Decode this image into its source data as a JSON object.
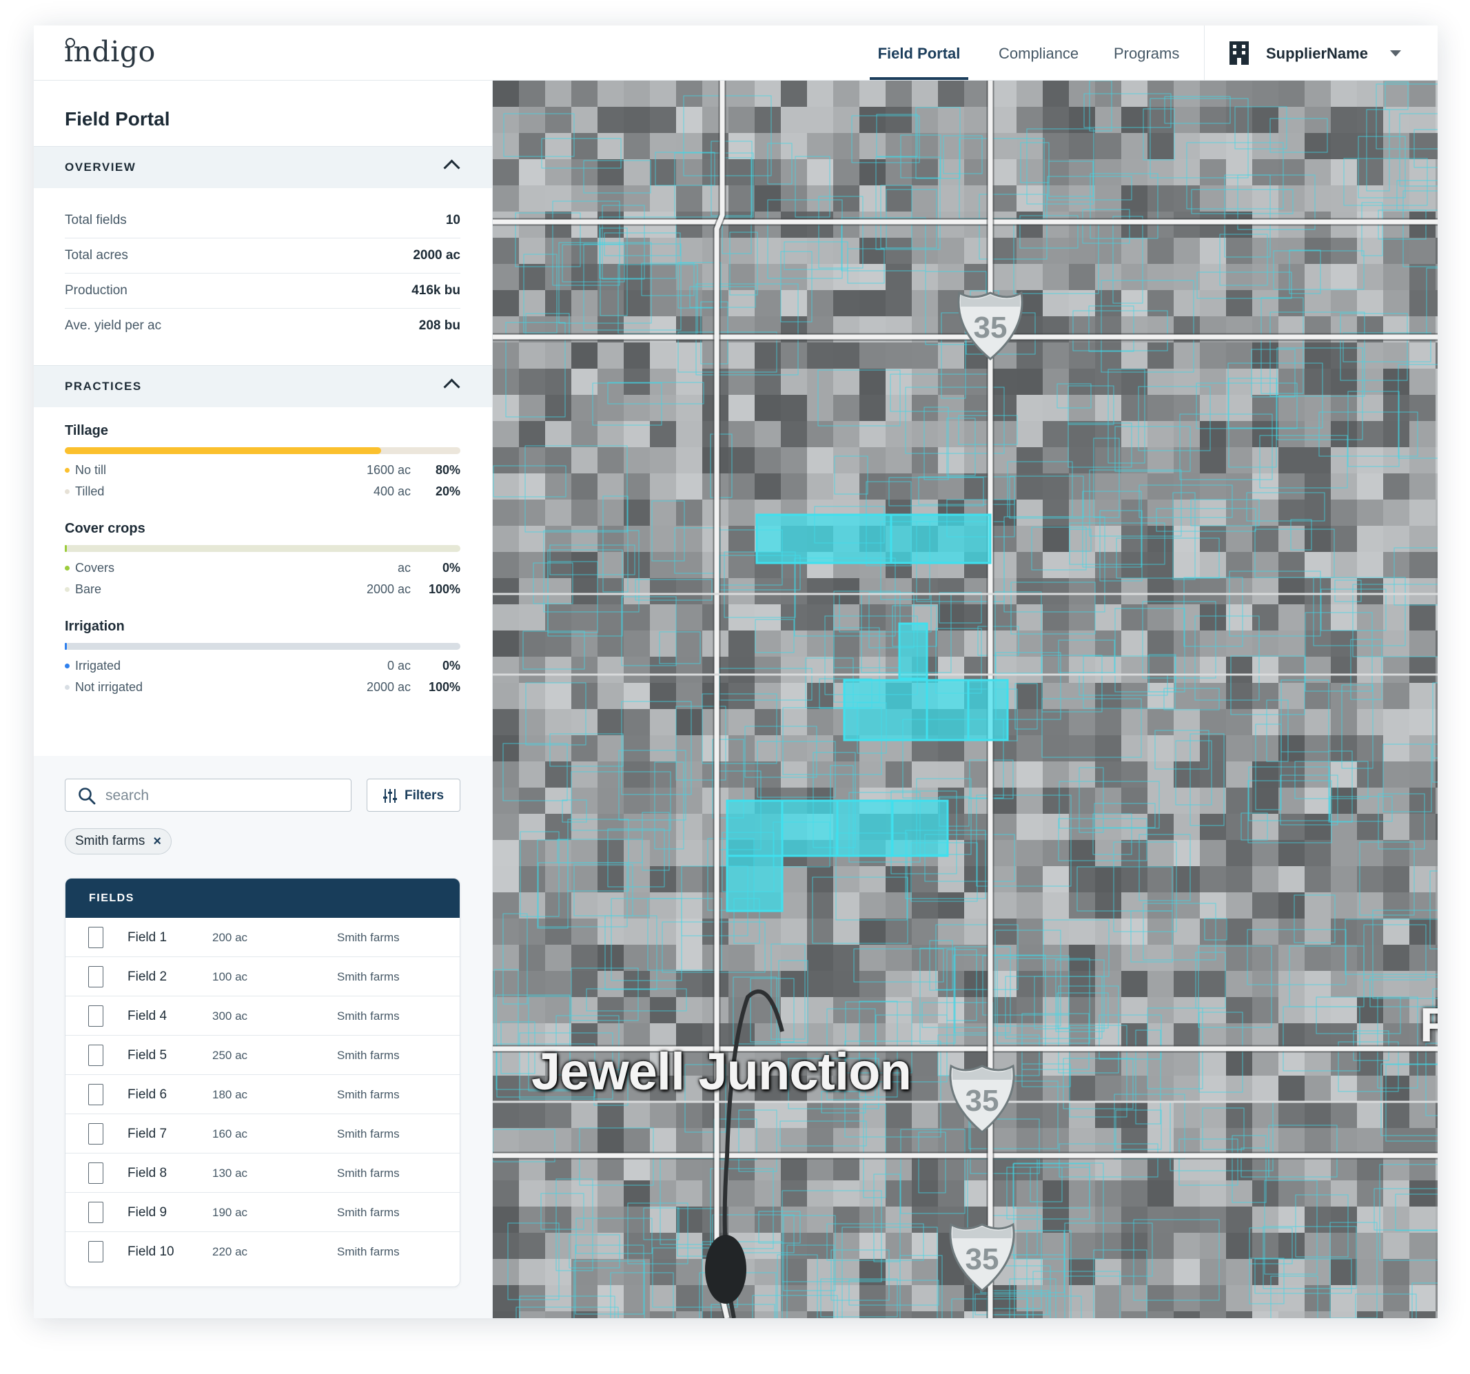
{
  "app": {
    "logo": "indigo",
    "nav": [
      "Field Portal",
      "Compliance",
      "Programs"
    ],
    "active_nav": "Field Portal",
    "supplier_name": "SupplierName"
  },
  "sidebar": {
    "title": "Field Portal",
    "overview": {
      "label": "OVERVIEW",
      "stats": [
        {
          "key": "Total fields",
          "value": "10"
        },
        {
          "key": "Total acres",
          "value": "2000 ac"
        },
        {
          "key": "Production",
          "value": "416k bu"
        },
        {
          "key": "Ave. yield per ac",
          "value": "208 bu"
        }
      ]
    },
    "practices": {
      "label": "PRACTICES",
      "groups": [
        {
          "title": "Tillage",
          "fill_fraction": 0.8,
          "fill_color": "#fbc02d",
          "track_color": "#ece6db",
          "items": [
            {
              "name": "No till",
              "acres": "1600 ac",
              "pct": "80%",
              "dot_color": "#fbc02d"
            },
            {
              "name": "Tilled",
              "acres": "400 ac",
              "pct": "20%",
              "dot_color": "#e6e1d6"
            }
          ]
        },
        {
          "title": "Cover crops",
          "fill_fraction": 0.0,
          "fill_color": "#9ccc3c",
          "track_color": "#e6e8d6",
          "items": [
            {
              "name": "Covers",
              "acres": "ac",
              "pct": "0%",
              "dot_color": "#9ccc3c"
            },
            {
              "name": "Bare",
              "acres": "2000 ac",
              "pct": "100%",
              "dot_color": "#e6e8d6"
            }
          ]
        },
        {
          "title": "Irrigation",
          "fill_fraction": 0.0,
          "fill_color": "#2f80ed",
          "track_color": "#d8dee4",
          "items": [
            {
              "name": "Irrigated",
              "acres": "0 ac",
              "pct": "0%",
              "dot_color": "#2f80ed"
            },
            {
              "name": "Not irrigated",
              "acres": "2000 ac",
              "pct": "100%",
              "dot_color": "#d8dee4"
            }
          ]
        }
      ]
    },
    "search": {
      "placeholder": "search",
      "value": ""
    },
    "filters_label": "Filters",
    "chip": {
      "label": "Smith farms",
      "remove": "×"
    },
    "fields": {
      "header": "FIELDS",
      "rows": [
        {
          "name": "Field 1",
          "acres": "200 ac",
          "farm": "Smith farms"
        },
        {
          "name": "Field 2",
          "acres": "100 ac",
          "farm": "Smith farms"
        },
        {
          "name": "Field 4",
          "acres": "300 ac",
          "farm": "Smith farms"
        },
        {
          "name": "Field 5",
          "acres": "250 ac",
          "farm": "Smith farms"
        },
        {
          "name": "Field 6",
          "acres": "180 ac",
          "farm": "Smith farms"
        },
        {
          "name": "Field 7",
          "acres": "160 ac",
          "farm": "Smith farms"
        },
        {
          "name": "Field 8",
          "acres": "130 ac",
          "farm": "Smith farms"
        },
        {
          "name": "Field 9",
          "acres": "190 ac",
          "farm": "Smith farms"
        },
        {
          "name": "Field 10",
          "acres": "220 ac",
          "farm": "Smith farms"
        }
      ]
    }
  },
  "map": {
    "city_label": "Jewell Junction",
    "edge_label": "R",
    "highway_number": "35",
    "highlight_color": "#3fe0ee",
    "outline_color": "#3fd6e6"
  }
}
